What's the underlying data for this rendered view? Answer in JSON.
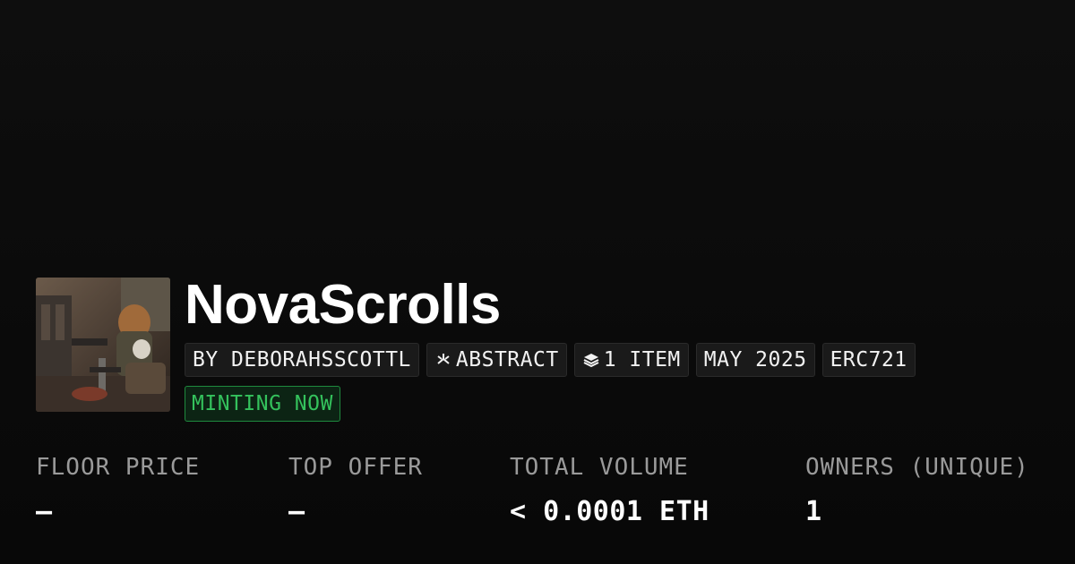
{
  "collection": {
    "name": "NovaScrolls",
    "tags": [
      {
        "label": "BY DEBORAHSSCOTTL",
        "icon": ""
      },
      {
        "label": "ABSTRACT",
        "icon": "abstract-chain-icon"
      },
      {
        "label": "1 ITEM",
        "icon": "layers-icon"
      },
      {
        "label": "MAY 2025",
        "icon": ""
      },
      {
        "label": "ERC721",
        "icon": ""
      }
    ],
    "status": "MINTING NOW"
  },
  "stats": [
    {
      "label": "FLOOR PRICE",
      "value": "—"
    },
    {
      "label": "TOP OFFER",
      "value": "—"
    },
    {
      "label": "TOTAL VOLUME",
      "value": "< 0.0001 ETH"
    },
    {
      "label": "OWNERS (UNIQUE)",
      "value": "1"
    }
  ],
  "colors": {
    "background": "#0b0b0b",
    "accent_green": "#34c15c",
    "label_gray": "#9a9a9a"
  }
}
